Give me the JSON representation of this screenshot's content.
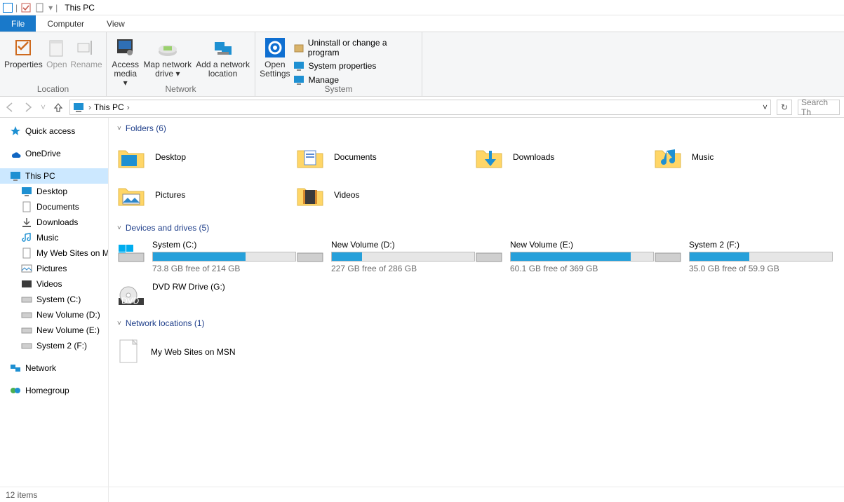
{
  "window_title": "This PC",
  "tabs": {
    "file": "File",
    "computer": "Computer",
    "view": "View"
  },
  "ribbon": {
    "location": {
      "label": "Location",
      "properties": "Properties",
      "open": "Open",
      "rename": "Rename"
    },
    "network": {
      "label": "Network",
      "access_media": "Access media",
      "map_drive": "Map network drive",
      "add_location": "Add a network location"
    },
    "settings": {
      "open_settings": "Open Settings"
    },
    "system": {
      "label": "System",
      "uninstall": "Uninstall or change a program",
      "properties": "System properties",
      "manage": "Manage"
    }
  },
  "addr": {
    "breadcrumb": "This PC",
    "search_placeholder": "Search Th"
  },
  "tree": {
    "quick_access": "Quick access",
    "onedrive": "OneDrive",
    "this_pc": "This PC",
    "desktop": "Desktop",
    "documents": "Documents",
    "downloads": "Downloads",
    "music": "Music",
    "my_web": "My Web Sites on M",
    "pictures": "Pictures",
    "videos": "Videos",
    "system_c": "System (C:)",
    "vol_d": "New Volume (D:)",
    "vol_e": "New Volume (E:)",
    "sys2_f": "System 2 (F:)",
    "network": "Network",
    "homegroup": "Homegroup"
  },
  "sections": {
    "folders_header": "Folders (6)",
    "drives_header": "Devices and drives (5)",
    "network_header": "Network locations (1)"
  },
  "folders": [
    {
      "name": "Desktop"
    },
    {
      "name": "Documents"
    },
    {
      "name": "Downloads"
    },
    {
      "name": "Music"
    },
    {
      "name": "Pictures"
    },
    {
      "name": "Videos"
    }
  ],
  "drives": [
    {
      "name": "System (C:)",
      "stats": "73.8 GB free of 214 GB",
      "fill": 65
    },
    {
      "name": "New Volume (D:)",
      "stats": "227 GB free of 286 GB",
      "fill": 21
    },
    {
      "name": "New Volume (E:)",
      "stats": "60.1 GB free of 369 GB",
      "fill": 84
    },
    {
      "name": "System 2 (F:)",
      "stats": "35.0 GB free of 59.9 GB",
      "fill": 42
    }
  ],
  "dvd": {
    "name": "DVD RW Drive (G:)"
  },
  "netloc": {
    "name": "My Web Sites on MSN"
  },
  "status": {
    "items": "12 items"
  }
}
